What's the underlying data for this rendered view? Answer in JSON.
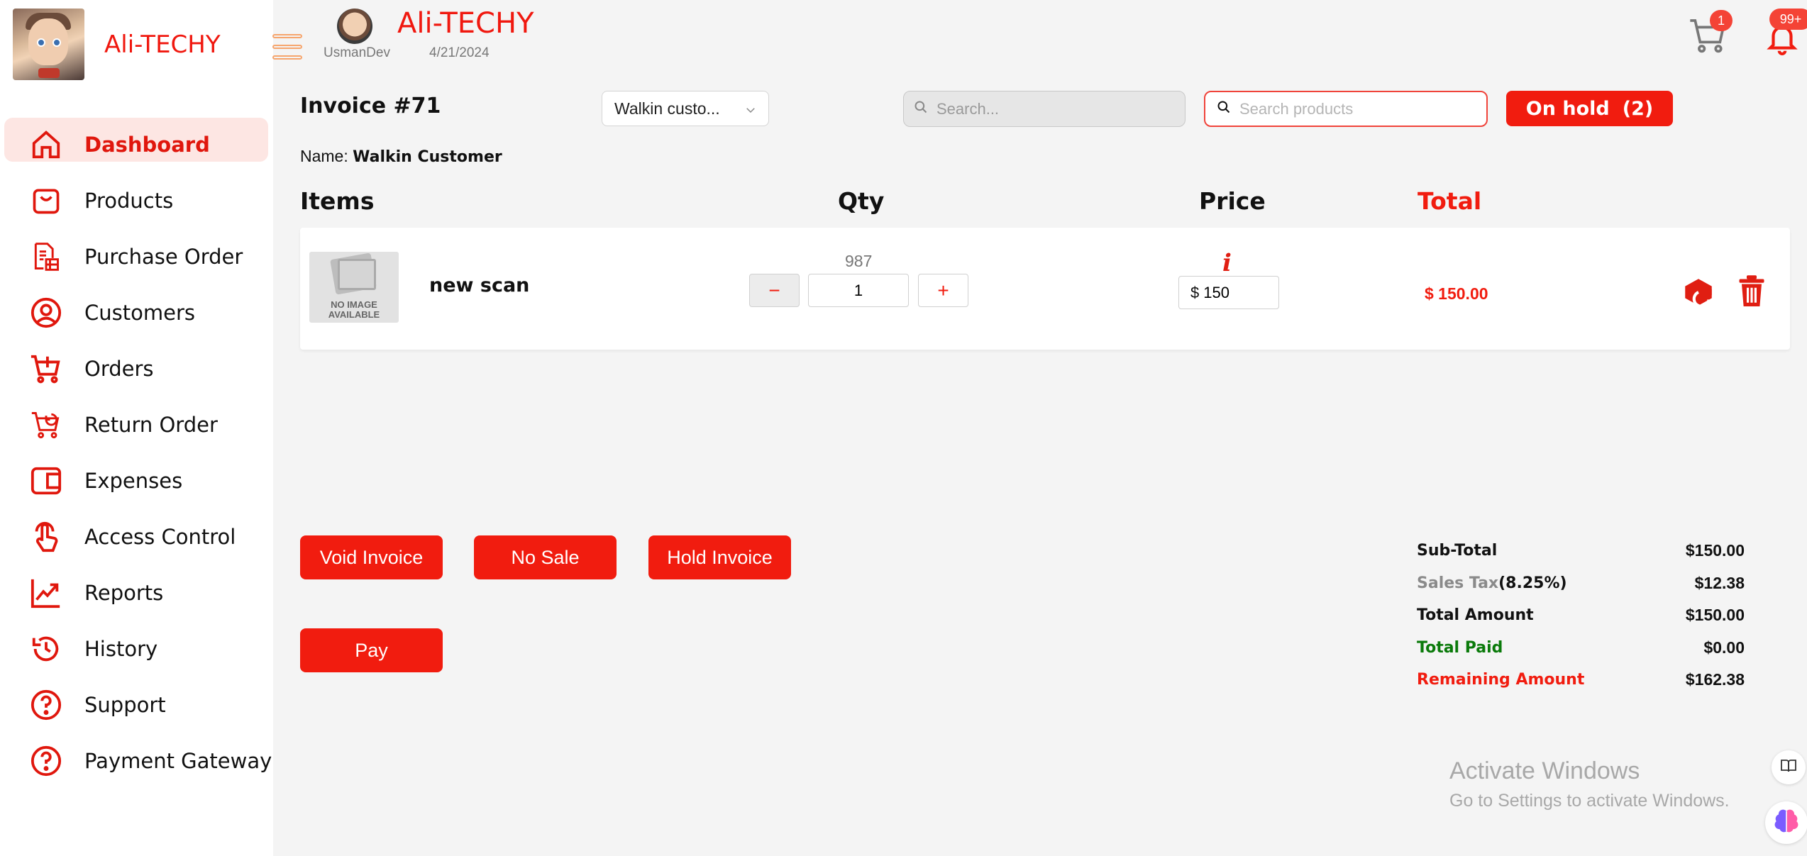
{
  "brand": {
    "name": "Ali-TECHY"
  },
  "sidebar": {
    "items": [
      {
        "label": "Dashboard",
        "icon": "home-icon",
        "active": true
      },
      {
        "label": "Products",
        "icon": "bag-icon"
      },
      {
        "label": "Purchase Order",
        "icon": "document-icon"
      },
      {
        "label": "Customers",
        "icon": "user-circle-icon"
      },
      {
        "label": "Orders",
        "icon": "cart-plus-icon"
      },
      {
        "label": "Return Order",
        "icon": "cart-return-icon"
      },
      {
        "label": "Expenses",
        "icon": "wallet-icon"
      },
      {
        "label": "Access Control",
        "icon": "touch-icon"
      },
      {
        "label": "Reports",
        "icon": "chart-line-icon"
      },
      {
        "label": "History",
        "icon": "history-icon"
      },
      {
        "label": "Support",
        "icon": "help-icon"
      },
      {
        "label": "Payment Gateway",
        "icon": "help-icon"
      }
    ]
  },
  "header": {
    "title": "Ali-TECHY",
    "username": "UsmanDev",
    "date": "4/21/2024",
    "cart_badge": "1",
    "notification_badge": "99+"
  },
  "invoice": {
    "title": "Invoice #71",
    "customer_select": "Walkin custo...",
    "name_label": "Name:",
    "customer_name": "Walkin Customer"
  },
  "search": {
    "placeholder": "Search..."
  },
  "search_products": {
    "placeholder": "Search products"
  },
  "on_hold": {
    "label": "On hold",
    "count": "(2)"
  },
  "columns": {
    "items": "Items",
    "qty": "Qty",
    "price": "Price",
    "total": "Total"
  },
  "items": [
    {
      "image_text_1": "NO IMAGE",
      "image_text_2": "AVAILABLE",
      "name": "new scan",
      "stock": "987",
      "qty": "1",
      "currency": "$",
      "price": "150",
      "total": "$ 150.00",
      "minus_label": "−",
      "plus_label": "+",
      "info_label": "i"
    }
  ],
  "actions": {
    "void": "Void Invoice",
    "no_sale": "No Sale",
    "hold": "Hold Invoice",
    "pay": "Pay"
  },
  "summary": {
    "subtotal_label": "Sub-Total",
    "subtotal": "$150.00",
    "tax_label": "Sales Tax",
    "tax_rate": "(8.25%)",
    "tax": "$12.38",
    "total_label": "Total Amount",
    "total": "$150.00",
    "paid_label": "Total Paid",
    "paid": "$0.00",
    "remaining_label": "Remaining Amount",
    "remaining": "$162.38"
  },
  "watermark": {
    "title": "Activate Windows",
    "subtitle": "Go to Settings to activate Windows."
  },
  "colors": {
    "accent": "#f11c0f",
    "active_bg": "#fde6e3",
    "paid": "#0a7a0a"
  }
}
